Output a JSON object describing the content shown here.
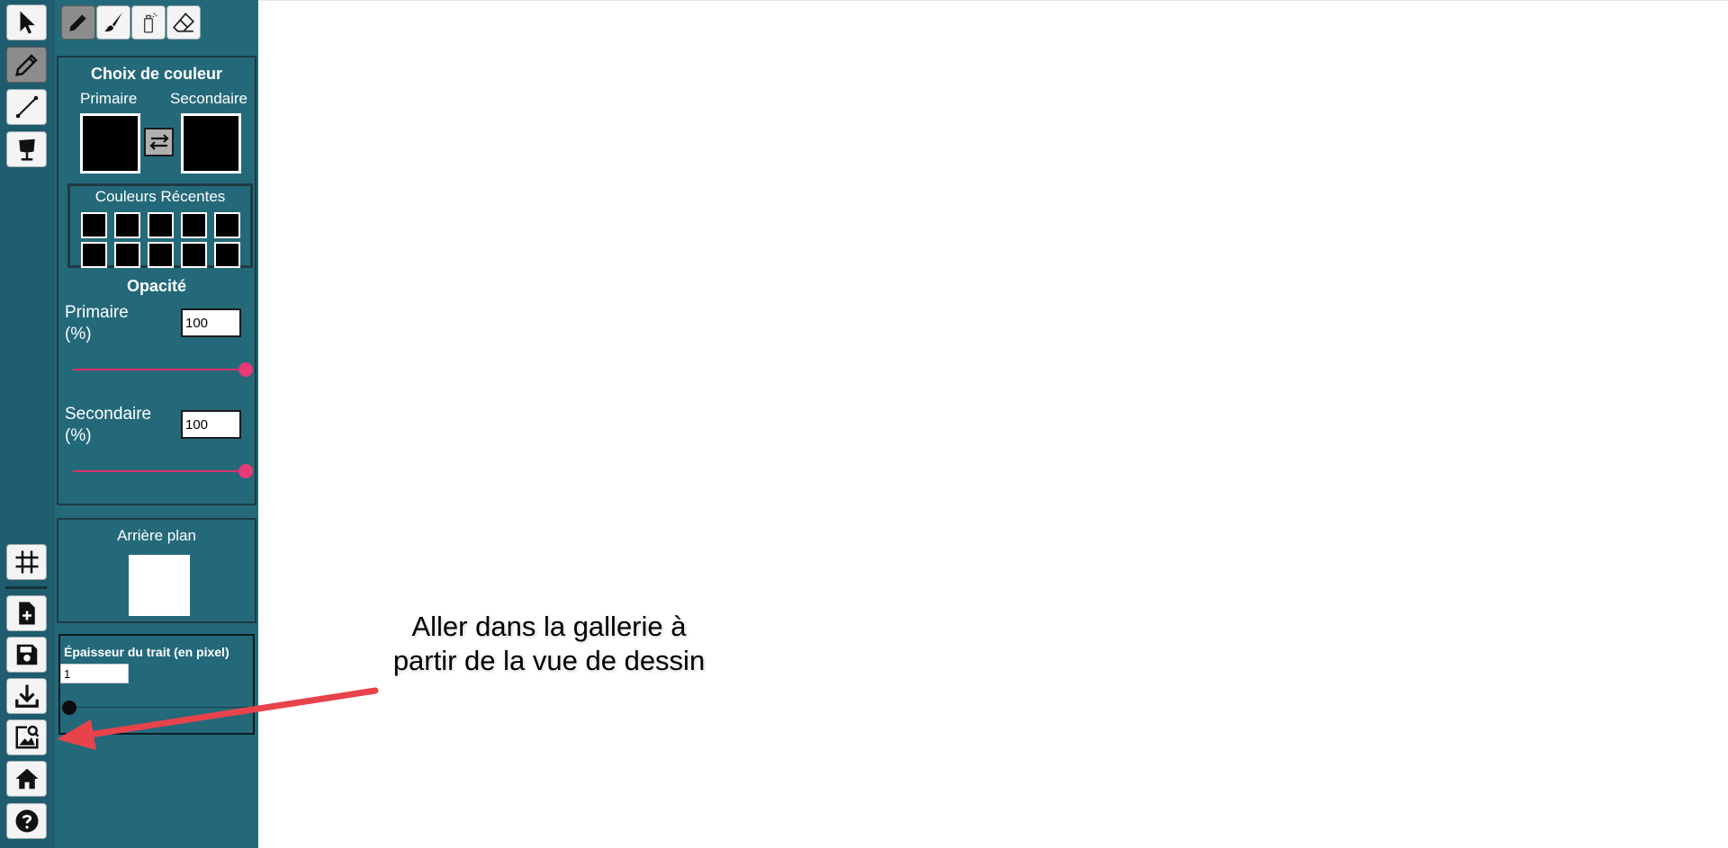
{
  "left_toolbar": {
    "tools": [
      {
        "name": "select",
        "icon": "cursor-arrow-icon",
        "active": false
      },
      {
        "name": "pencil",
        "icon": "pencil-icon",
        "active": true
      },
      {
        "name": "line",
        "icon": "line-icon",
        "active": false
      },
      {
        "name": "stamp",
        "icon": "paint-bucket-icon",
        "active": false
      }
    ],
    "bottom_tools": [
      {
        "name": "grid",
        "icon": "grid-icon"
      },
      {
        "name": "new-file",
        "icon": "new-file-icon"
      },
      {
        "name": "save",
        "icon": "save-icon"
      },
      {
        "name": "download",
        "icon": "download-icon"
      },
      {
        "name": "gallery",
        "icon": "gallery-search-icon"
      },
      {
        "name": "home",
        "icon": "home-icon"
      },
      {
        "name": "help",
        "icon": "help-icon"
      }
    ]
  },
  "sub_tools": [
    {
      "name": "pencil",
      "icon": "pencil-icon",
      "active": true
    },
    {
      "name": "brush",
      "icon": "brush-icon",
      "active": false
    },
    {
      "name": "spray",
      "icon": "spray-can-icon",
      "active": false
    },
    {
      "name": "eraser",
      "icon": "eraser-icon",
      "active": false
    }
  ],
  "color_panel": {
    "title": "Choix de couleur",
    "primary_label": "Primaire",
    "secondary_label": "Secondaire",
    "primary_color": "#000000",
    "secondary_color": "#000000",
    "recent_title": "Couleurs Récentes",
    "recent_colors": [
      "#000000",
      "#000000",
      "#000000",
      "#000000",
      "#000000",
      "#000000",
      "#000000",
      "#000000",
      "#000000",
      "#000000"
    ]
  },
  "opacity": {
    "title": "Opacité",
    "primary_label": "Primaire",
    "primary_unit": "(%)",
    "primary_value": "100",
    "secondary_label": "Secondaire",
    "secondary_unit": "(%)",
    "secondary_value": "100"
  },
  "background": {
    "title": "Arrière plan",
    "color": "#ffffff"
  },
  "stroke": {
    "title": "Épaisseur du trait (en pixel)",
    "value": "1"
  },
  "annotation": {
    "line1": "Aller dans la gallerie à",
    "line2": "partir de la vue de dessin",
    "arrow_color": "#e8434b"
  },
  "colors": {
    "toolbar_bg": "#1e5c6e",
    "panel_bg": "#24697a",
    "slider_accent": "#e83a77"
  }
}
